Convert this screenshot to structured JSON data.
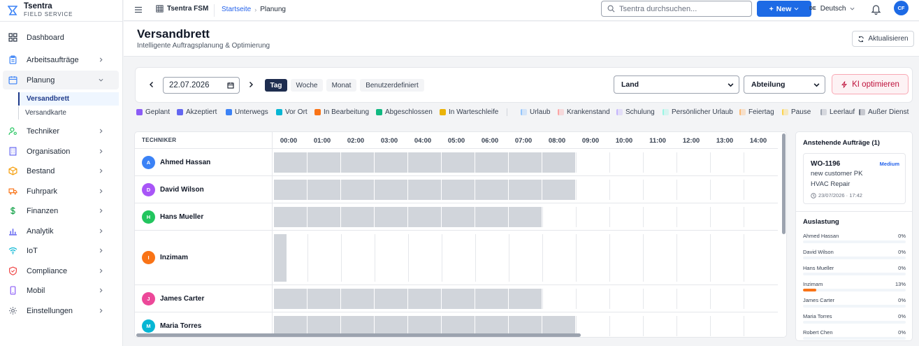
{
  "brand": {
    "name": "Tsentra",
    "subtitle": "FIELD SERVICE"
  },
  "sidebar": {
    "dashboard": "Dashboard",
    "items": [
      {
        "label": "Arbeitsaufträge",
        "icon": "clipboard-icon",
        "color": "#3b82f6"
      },
      {
        "label": "Planung",
        "icon": "calendar-icon",
        "color": "#3b82f6"
      },
      {
        "label": "Techniker",
        "icon": "user-gear-icon",
        "color": "#22c55e"
      },
      {
        "label": "Organisation",
        "icon": "building-icon",
        "color": "#6366f1"
      },
      {
        "label": "Bestand",
        "icon": "box-icon",
        "color": "#f59e0b"
      },
      {
        "label": "Fuhrpark",
        "icon": "truck-icon",
        "color": "#f97316"
      },
      {
        "label": "Finanzen",
        "icon": "dollar-icon",
        "color": "#16a34a"
      },
      {
        "label": "Analytik",
        "icon": "chart-icon",
        "color": "#6366f1"
      },
      {
        "label": "IoT",
        "icon": "wifi-icon",
        "color": "#06b6d4"
      },
      {
        "label": "Compliance",
        "icon": "shield-icon",
        "color": "#ef4444"
      },
      {
        "label": "Mobil",
        "icon": "phone-icon",
        "color": "#8b5cf6"
      },
      {
        "label": "Einstellungen",
        "icon": "gear-icon",
        "color": "#6b7280"
      }
    ],
    "sub_items": [
      "Versandbrett",
      "Versandkarte"
    ]
  },
  "topbar": {
    "app": "Tsentra FSM",
    "breadcrumb": [
      "Startseite",
      "Planung"
    ],
    "search_placeholder": "Tsentra durchsuchen...",
    "new_label": "New",
    "lang_code": "DE",
    "lang": "Deutsch",
    "avatar": "CF"
  },
  "page": {
    "title": "Versandbrett",
    "subtitle": "Intelligente Auftragsplanung & Optimierung",
    "refresh": "Aktualisieren"
  },
  "controls": {
    "date": "22.07.2026",
    "views": [
      "Tag",
      "Woche",
      "Monat",
      "Benutzerdefiniert"
    ],
    "active_view": "Tag",
    "land": "Land",
    "abteilung": "Abteilung",
    "ki": "KI optimieren"
  },
  "legend": {
    "status": [
      {
        "label": "Geplant",
        "color": "#8b5cf6"
      },
      {
        "label": "Akzeptiert",
        "color": "#6366f1"
      },
      {
        "label": "Unterwegs",
        "color": "#3b82f6"
      },
      {
        "label": "Vor Ort",
        "color": "#06b6d4"
      },
      {
        "label": "In Bearbeitung",
        "color": "#f97316"
      },
      {
        "label": "Abgeschlossen",
        "color": "#10b981"
      },
      {
        "label": "In Warteschleife",
        "color": "#eab308"
      }
    ],
    "absence": [
      {
        "label": "Urlaub",
        "color": "#93c5fd"
      },
      {
        "label": "Krankenstand",
        "color": "#fca5a5"
      },
      {
        "label": "Schulung",
        "color": "#c4b5fd"
      },
      {
        "label": "Persönlicher Urlaub",
        "color": "#99f6e4"
      },
      {
        "label": "Feiertag",
        "color": "#fdba74"
      },
      {
        "label": "Pause",
        "color": "#fcd34d"
      },
      {
        "label": "Leerlauf",
        "color": "#9ca3af"
      },
      {
        "label": "Außer Dienst",
        "color": "#6b7280"
      }
    ]
  },
  "grid": {
    "header": "TECHNIKER",
    "hours": [
      "00:00",
      "01:00",
      "02:00",
      "03:00",
      "04:00",
      "05:00",
      "06:00",
      "07:00",
      "08:00",
      "09:00",
      "10:00",
      "11:00",
      "12:00",
      "13:00",
      "14:00"
    ],
    "rows": [
      {
        "name": "Ahmed Hassan",
        "initial": "A",
        "color": "#3b82f6",
        "busy_hours": 9
      },
      {
        "name": "David Wilson",
        "initial": "D",
        "color": "#a855f7",
        "busy_hours": 9
      },
      {
        "name": "Hans Mueller",
        "initial": "H",
        "color": "#22c55e",
        "busy_hours": 8
      },
      {
        "name": "Inzimam",
        "initial": "I",
        "color": "#f97316",
        "busy_hours": 0.4
      },
      {
        "name": "James Carter",
        "initial": "J",
        "color": "#ec4899",
        "busy_hours": 8
      },
      {
        "name": "Maria Torres",
        "initial": "M",
        "color": "#06b6d4",
        "busy_hours": 9
      }
    ]
  },
  "panel": {
    "pending_title": "Anstehende Aufträge (1)",
    "card": {
      "id": "WO-1196",
      "priority": "Medium",
      "customer": "new customer PK",
      "type": "HVAC Repair",
      "due": "23/07/2026 · 17:42"
    },
    "util_title": "Auslastung",
    "utilization": [
      {
        "name": "Ahmed Hassan",
        "pct": "0%",
        "value": 0
      },
      {
        "name": "David Wilson",
        "pct": "0%",
        "value": 0
      },
      {
        "name": "Hans Mueller",
        "pct": "0%",
        "value": 0
      },
      {
        "name": "Inzimam",
        "pct": "13%",
        "value": 13
      },
      {
        "name": "James Carter",
        "pct": "0%",
        "value": 0
      },
      {
        "name": "Maria Torres",
        "pct": "0%",
        "value": 0
      },
      {
        "name": "Robert Chen",
        "pct": "0%",
        "value": 0
      }
    ]
  }
}
